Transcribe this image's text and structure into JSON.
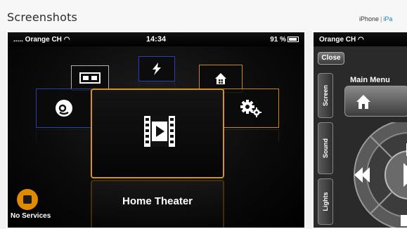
{
  "page": {
    "title": "Screenshots"
  },
  "device_tabs": {
    "iphone": "iPhone",
    "separator": "|",
    "ipad": "iPa"
  },
  "screenshot1": {
    "status": {
      "carrier": "..... Orange CH",
      "time": "14:34",
      "battery": "91 %"
    },
    "selected_label": "Home Theater",
    "no_services_label": "No Services",
    "tiles": [
      {
        "name": "tv-tile",
        "icon": "tv-icon",
        "color": "#b0b0b0"
      },
      {
        "name": "power-tile",
        "icon": "lightning-icon",
        "color": "#2a3fb0"
      },
      {
        "name": "house-tile",
        "icon": "house-icon",
        "color": "#c9861a"
      },
      {
        "name": "music-tile",
        "icon": "music-icon",
        "color": "#2a3fb0"
      },
      {
        "name": "settings-tile",
        "icon": "gears-icon",
        "color": "#c9861a"
      }
    ],
    "accent_color": "#d9940d"
  },
  "screenshot2": {
    "status": {
      "carrier": "Orange CH"
    },
    "close_label": "Close",
    "side_tabs": [
      "Screen",
      "Sound",
      "Lights"
    ],
    "main_menu_label": "Main Menu"
  }
}
